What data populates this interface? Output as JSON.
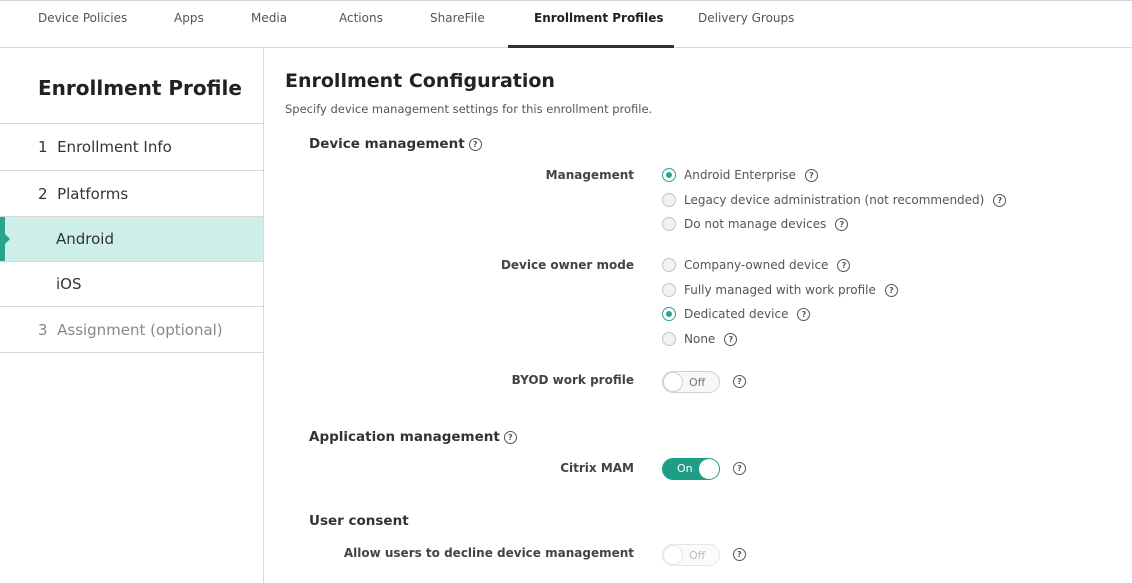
{
  "tabs": [
    {
      "label": "Device Policies"
    },
    {
      "label": "Apps"
    },
    {
      "label": "Media"
    },
    {
      "label": "Actions"
    },
    {
      "label": "ShareFile"
    },
    {
      "label": "Enrollment Profiles"
    },
    {
      "label": "Delivery Groups"
    }
  ],
  "sidebar": {
    "title": "Enrollment Profile",
    "items": [
      {
        "label": "1  Enrollment Info"
      },
      {
        "label": "2  Platforms"
      },
      {
        "label": "Android"
      },
      {
        "label": "iOS"
      },
      {
        "label": "3  Assignment (optional)"
      }
    ]
  },
  "main": {
    "title": "Enrollment Configuration",
    "subtitle": "Specify device management settings for this enrollment profile.",
    "help_glyph": "?",
    "device_management": {
      "title": "Device management",
      "management": {
        "label": "Management",
        "options": [
          {
            "label": "Android Enterprise",
            "checked": true
          },
          {
            "label": "Legacy device administration (not recommended)",
            "checked": false
          },
          {
            "label": "Do not manage devices",
            "checked": false
          }
        ]
      },
      "owner_mode": {
        "label": "Device owner mode",
        "options": [
          {
            "label": "Company-owned device",
            "checked": false
          },
          {
            "label": "Fully managed with work profile",
            "checked": false
          },
          {
            "label": "Dedicated device",
            "checked": true
          },
          {
            "label": "None",
            "checked": false
          }
        ]
      },
      "byod": {
        "label": "BYOD work profile",
        "state": "Off"
      }
    },
    "application_management": {
      "title": "Application management",
      "citrix_mam": {
        "label": "Citrix MAM",
        "state": "On"
      }
    },
    "user_consent": {
      "title": "User consent",
      "allow_decline": {
        "label": "Allow users to decline device management",
        "state": "Off"
      }
    }
  },
  "colors": {
    "accent": "#1e9e87",
    "sidebar_active_bg": "#cdeee9"
  }
}
